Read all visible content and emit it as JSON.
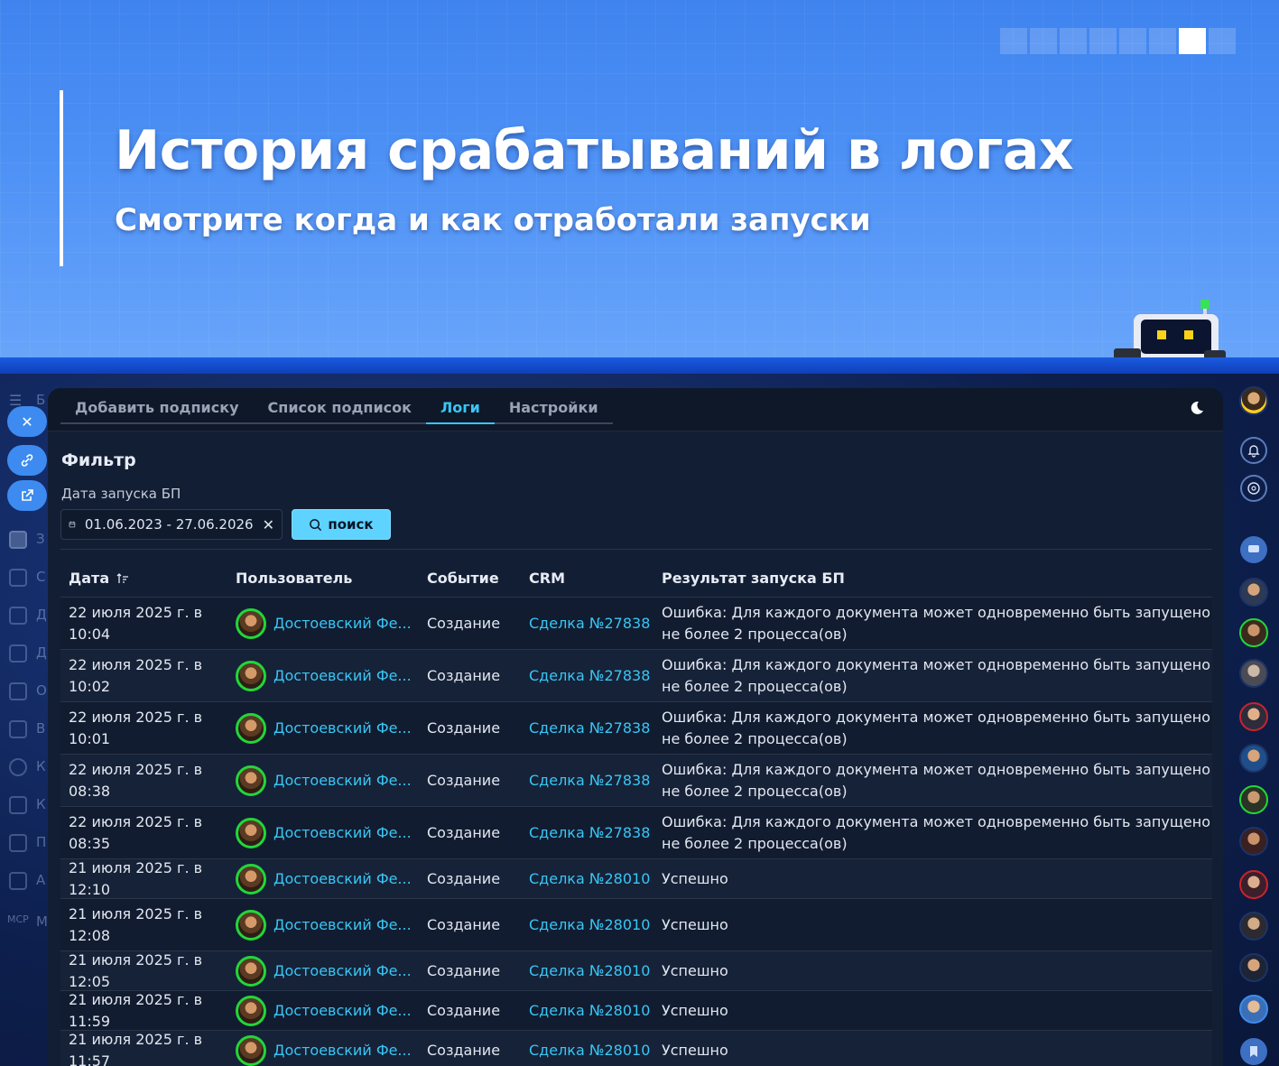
{
  "banner": {
    "title": "История срабатываний в логах",
    "subtitle": "Смотрите когда и как отработали запуски",
    "progress": {
      "total": 8,
      "active_index": 6
    }
  },
  "left_rail": {
    "labels": [
      "Б",
      "З",
      "С",
      "Д",
      "Д",
      "О",
      "В",
      "К",
      "К",
      "П",
      "А",
      "М"
    ],
    "mcp_label": "MCP"
  },
  "tabs": [
    {
      "label": "Добавить подписку",
      "active": false
    },
    {
      "label": "Список подписок",
      "active": false
    },
    {
      "label": "Логи",
      "active": true
    },
    {
      "label": "Настройки",
      "active": false
    }
  ],
  "filter": {
    "title": "Фильтр",
    "date_label": "Дата запуска БП",
    "date_value": "01.06.2023 - 27.06.2026",
    "search_label": "поиск"
  },
  "table": {
    "columns": [
      "Дата",
      "Пользователь",
      "Событие",
      "CRM",
      "Результат запуска БП"
    ],
    "rows": [
      {
        "date": "22 июля 2025 г. в 10:04",
        "user": "Достоевский Фе...",
        "event": "Создание",
        "crm": "Сделка №27838",
        "result": "Ошибка: Для каждого документа может одновременно быть запущено не более 2 процесса(ов)"
      },
      {
        "date": "22 июля 2025 г. в 10:02",
        "user": "Достоевский Фе...",
        "event": "Создание",
        "crm": "Сделка №27838",
        "result": "Ошибка: Для каждого документа может одновременно быть запущено не более 2 процесса(ов)"
      },
      {
        "date": "22 июля 2025 г. в 10:01",
        "user": "Достоевский Фе...",
        "event": "Создание",
        "crm": "Сделка №27838",
        "result": "Ошибка: Для каждого документа может одновременно быть запущено не более 2 процесса(ов)"
      },
      {
        "date": "22 июля 2025 г. в 08:38",
        "user": "Достоевский Фе...",
        "event": "Создание",
        "crm": "Сделка №27838",
        "result": "Ошибка: Для каждого документа может одновременно быть запущено не более 2 процесса(ов)"
      },
      {
        "date": "22 июля 2025 г. в 08:35",
        "user": "Достоевский Фе...",
        "event": "Создание",
        "crm": "Сделка №27838",
        "result": "Ошибка: Для каждого документа может одновременно быть запущено не более 2 процесса(ов)"
      },
      {
        "date": "21 июля 2025 г. в 12:10",
        "user": "Достоевский Фе...",
        "event": "Создание",
        "crm": "Сделка №28010",
        "result": "Успешно"
      },
      {
        "date": "21 июля 2025 г. в 12:08",
        "user": "Достоевский Фе...",
        "event": "Создание",
        "crm": "Сделка №28010",
        "result": "Успешно"
      },
      {
        "date": "21 июля 2025 г. в 12:05",
        "user": "Достоевский Фе...",
        "event": "Создание",
        "crm": "Сделка №28010",
        "result": "Успешно"
      },
      {
        "date": "21 июля 2025 г. в 11:59",
        "user": "Достоевский Фе...",
        "event": "Создание",
        "crm": "Сделка №28010",
        "result": "Успешно"
      },
      {
        "date": "21 июля 2025 г. в 11:57",
        "user": "Достоевский Фе...",
        "event": "Создание",
        "crm": "Сделка №28010",
        "result": "Успешно"
      }
    ]
  },
  "colors": {
    "accent": "#39c6f5",
    "search_button": "#5ed3ff",
    "panel_bg": "#121e33",
    "banner_blue": "#4c90f5",
    "avatar_ring": "#22d63a"
  },
  "icons": [
    "close-icon",
    "link-icon",
    "external-link-icon",
    "moon-icon",
    "calendar-icon",
    "search-icon",
    "sort-icon",
    "bell-icon",
    "chat-icon",
    "bookmark-icon"
  ]
}
